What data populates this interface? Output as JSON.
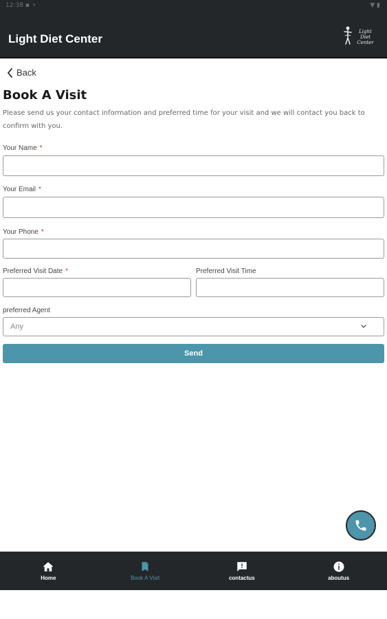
{
  "status_bar": {
    "left": "12:38 ▪ ⚬",
    "right": "▼ ▮"
  },
  "header": {
    "title": "Light Diet Center",
    "logo_text_line1": "Light Diet",
    "logo_text_line2": "Center"
  },
  "back": {
    "label": "Back"
  },
  "page": {
    "title": "Book A Visit",
    "intro": "Please send us your contact information and preferred time for your visit and we will contact you back to confirm with you."
  },
  "form": {
    "name": {
      "label": "Your Name",
      "required": "*",
      "value": ""
    },
    "email": {
      "label": "Your Email",
      "required": "*",
      "value": ""
    },
    "phone": {
      "label": "Your Phone",
      "required": "*",
      "value": ""
    },
    "visit_date": {
      "label": "Preferred Visit Date",
      "required": "*",
      "value": ""
    },
    "visit_time": {
      "label": "Preferred Visit Time",
      "value": ""
    },
    "agent": {
      "label": "preferred Agent",
      "selected": "Any"
    },
    "send_label": "Send"
  },
  "bottom_nav": {
    "items": [
      {
        "label": "Home",
        "icon": "home-icon"
      },
      {
        "label": "Book A Visit",
        "icon": "bookmark-icon",
        "active": true
      },
      {
        "label": "contactus",
        "icon": "chat-icon"
      },
      {
        "label": "aboutus",
        "icon": "info-icon"
      }
    ]
  },
  "colors": {
    "bar": "#23272a",
    "accent": "#4d95aa",
    "required": "#d32f2f"
  }
}
